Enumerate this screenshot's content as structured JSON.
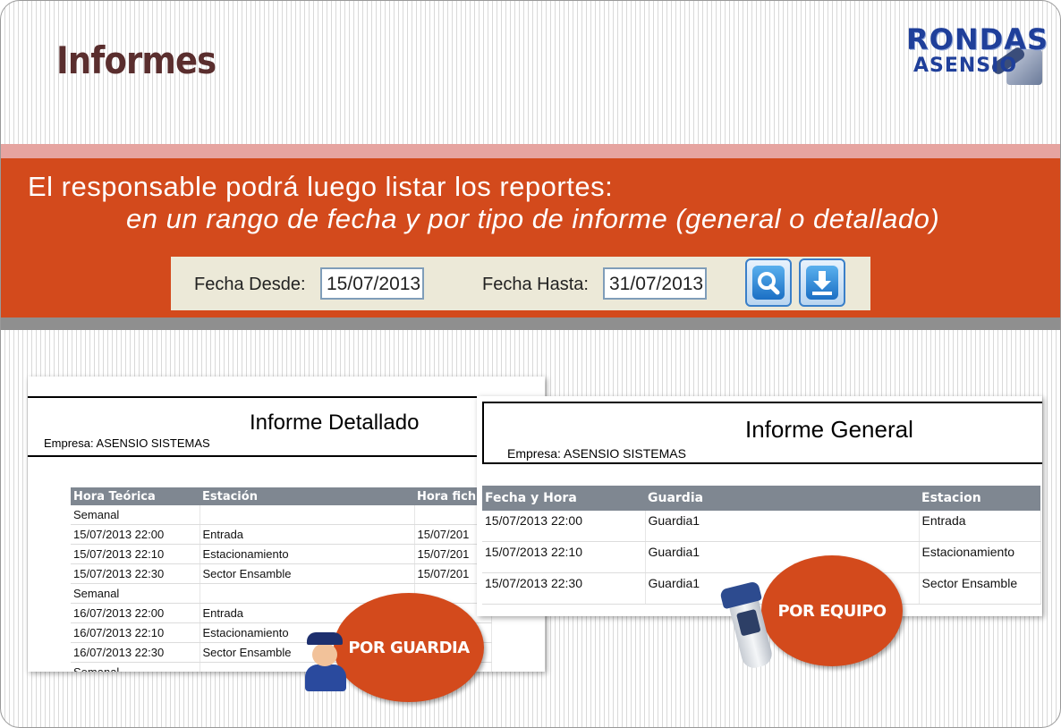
{
  "slide": {
    "title": "Informes",
    "logo": {
      "line1": "RONDAS",
      "line2": "ASENSIO"
    },
    "heading": {
      "line1": "El responsable podrá luego listar los reportes:",
      "line2": "en un rango de fecha y por tipo de informe (general o detallado)"
    },
    "colors": {
      "band": "#d34a1c",
      "band_light": "#e6a4a0",
      "title": "#5a2e2e"
    }
  },
  "filter": {
    "fecha_desde_label": "Fecha Desde:",
    "fecha_desde_value": "15/07/2013",
    "fecha_hasta_label": "Fecha Hasta:",
    "fecha_hasta_value": "31/07/2013",
    "search_icon": "search-icon",
    "download_icon": "download-icon"
  },
  "report_detallado": {
    "title": "Informe Detallado",
    "empresa": "Empresa: ASENSIO SISTEMAS",
    "columns": [
      "Hora Teórica",
      "Estación",
      "Hora fich"
    ],
    "rows": [
      [
        "Semanal",
        "",
        ""
      ],
      [
        "15/07/2013 22:00",
        "Entrada",
        "15/07/201"
      ],
      [
        "15/07/2013 22:10",
        "Estacionamiento",
        "15/07/201"
      ],
      [
        "15/07/2013 22:30",
        "Sector Ensamble",
        "15/07/201"
      ],
      [
        "Semanal",
        "",
        ""
      ],
      [
        "16/07/2013 22:00",
        "Entrada",
        ""
      ],
      [
        "16/07/2013 22:10",
        "Estacionamiento",
        ""
      ],
      [
        "16/07/2013 22:30",
        "Sector Ensamble",
        ""
      ],
      [
        "Semanal",
        "",
        ""
      ]
    ]
  },
  "report_general": {
    "title": "Informe General",
    "empresa": "Empresa: ASENSIO SISTEMAS",
    "columns": [
      "Fecha y Hora",
      "Guardia",
      "Estacion"
    ],
    "rows": [
      [
        "15/07/2013 22:00",
        "Guardia1",
        "Entrada"
      ],
      [
        "15/07/2013 22:10",
        "Guardia1",
        "Estacionamiento"
      ],
      [
        "15/07/2013 22:30",
        "Guardia1",
        "Sector Ensamble"
      ]
    ]
  },
  "badges": {
    "guardia": "POR GUARDIA",
    "equipo": "POR EQUIPO"
  }
}
